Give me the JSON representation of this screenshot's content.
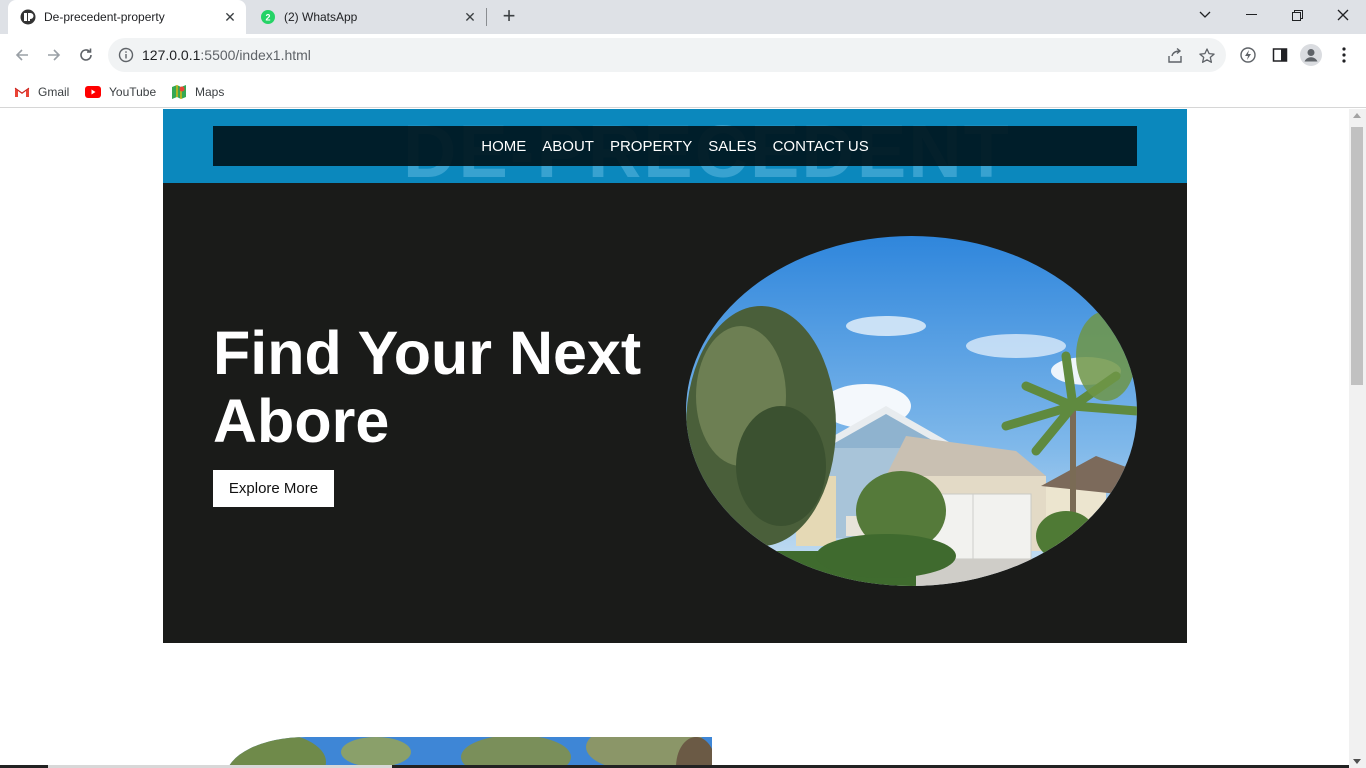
{
  "browser": {
    "tabs": [
      {
        "title": "De-precedent-property",
        "active": true,
        "icon": "site-logo-icon"
      },
      {
        "title": "(2) WhatsApp",
        "active": false,
        "icon": "whatsapp-icon",
        "badge": "2"
      }
    ],
    "url_host": "127.0.0.1",
    "url_path": ":5500/index1.html",
    "bookmarks": [
      {
        "label": "Gmail",
        "icon": "gmail-icon"
      },
      {
        "label": "YouTube",
        "icon": "youtube-icon"
      },
      {
        "label": "Maps",
        "icon": "maps-icon"
      }
    ]
  },
  "header": {
    "watermark": "DE-PRECEDENT",
    "nav": [
      "HOME",
      "ABOUT",
      "PROPERTY",
      "SALES",
      "CONTACT US"
    ]
  },
  "hero": {
    "title": "Find Your Next Abore",
    "button": "Explore More",
    "image": "house-photo"
  },
  "colors": {
    "header_bg": "#0b88bd",
    "nav_bg": "#00161e",
    "hero_bg": "#1a1b19",
    "button_bg": "#ffffff"
  }
}
